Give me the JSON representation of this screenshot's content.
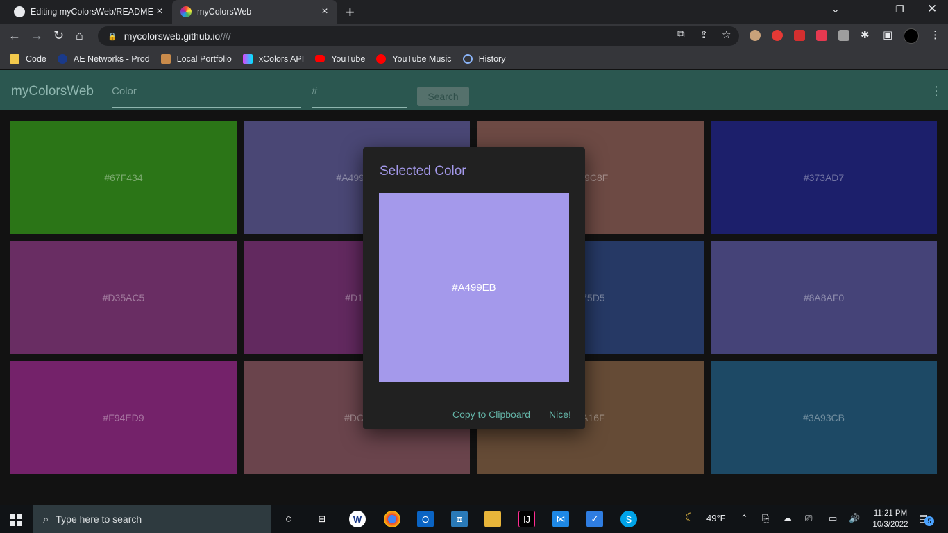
{
  "browser": {
    "tabs": [
      {
        "title": "Editing myColorsWeb/README.m",
        "icon": "github-icon",
        "active": false
      },
      {
        "title": "myColorsWeb",
        "icon": "colorwheel-icon",
        "active": true
      }
    ],
    "url_host": "mycolorsweb.github.io",
    "url_path": "/#/",
    "bookmarks": [
      {
        "label": "Code",
        "icon": "folder-icon",
        "color": "#f2c94c"
      },
      {
        "label": "AE Networks - Prod",
        "icon": "ae-icon",
        "color": "#1a3a8a"
      },
      {
        "label": "Local Portfolio",
        "icon": "portfolio-icon",
        "color": "#c98b4b"
      },
      {
        "label": "xColors API",
        "icon": "xcolors-icon",
        "color": "#e040fb"
      },
      {
        "label": "YouTube",
        "icon": "youtube-icon",
        "color": "#ff0000"
      },
      {
        "label": "YouTube Music",
        "icon": "youtube-music-icon",
        "color": "#ff0000"
      },
      {
        "label": "History",
        "icon": "history-icon",
        "color": "#8ab4f8"
      }
    ]
  },
  "app": {
    "brand": "myColorsWeb",
    "color_placeholder": "Color",
    "hex_placeholder": "#",
    "search_label": "Search",
    "accent": "#2b5750"
  },
  "swatches": [
    {
      "hex": "#67F434",
      "bg": "#2b7517"
    },
    {
      "hex": "#A499EB",
      "bg": "#4a4775"
    },
    {
      "hex": "#F9C8F",
      "bg": "#6d4a44"
    },
    {
      "hex": "#373AD7",
      "bg": "#1c1f6b"
    },
    {
      "hex": "#D35AC5",
      "bg": "#692d63"
    },
    {
      "hex": "#D15",
      "bg": "#62295f"
    },
    {
      "hex": "375D5",
      "bg": "#263965"
    },
    {
      "hex": "#8A8AF0",
      "bg": "#454378"
    },
    {
      "hex": "#F94ED9",
      "bg": "#74226a"
    },
    {
      "hex": "#DC8",
      "bg": "#6a444c"
    },
    {
      "hex": "3A16F",
      "bg": "#654b36"
    },
    {
      "hex": "#3A93CB",
      "bg": "#1d4965"
    }
  ],
  "dialog": {
    "title": "Selected Color",
    "color_hex": "#A499EB",
    "color_value": "#a499eb",
    "copy_label": "Copy to Clipboard",
    "nice_label": "Nice!"
  },
  "taskbar": {
    "search_placeholder": "Type here to search",
    "weather": "49°F",
    "time": "11:21 PM",
    "date": "10/3/2022",
    "notification_count": "5"
  }
}
